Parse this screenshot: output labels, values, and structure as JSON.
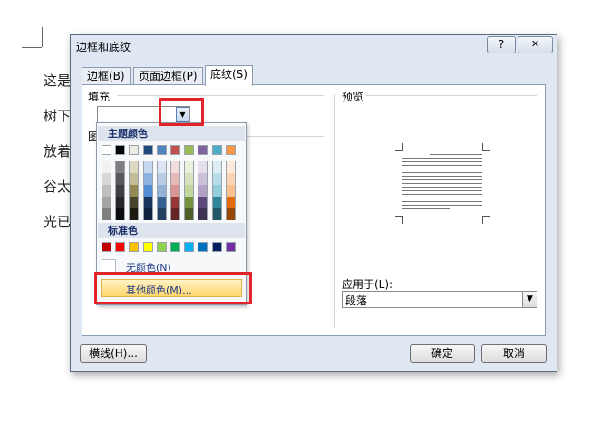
{
  "background_doc": {
    "lines": [
      "这是",
      "树下",
      "放着",
      "谷太",
      "光已"
    ]
  },
  "dialog": {
    "title": "边框和底纹",
    "help_label": "?",
    "close_label": "✕",
    "tabs": [
      {
        "label": "边框(B)"
      },
      {
        "label": "页面边框(P)"
      },
      {
        "label": "底纹(S)"
      }
    ],
    "fill_label": "填充",
    "pattern_label_partial": "图",
    "preview_label": "预览",
    "apply_to_label": "应用于(L):",
    "apply_to_value": "段落",
    "horizontal_line_button": "横线(H)...",
    "ok_button": "确定",
    "cancel_button": "取消"
  },
  "color_dropdown": {
    "theme_header": "主题颜色",
    "standard_header": "标准色",
    "no_color_label": "无颜色(N)",
    "more_colors_label": "其他颜色(M)...",
    "theme_top": [
      "#ffffff",
      "#000000",
      "#eeece1",
      "#1f497d",
      "#4f81bd",
      "#c0504d",
      "#9bbb59",
      "#8064a2",
      "#4bacc6",
      "#f79646"
    ],
    "theme_shades": [
      [
        "#f2f2f2",
        "#7f7f7f",
        "#ddd9c3",
        "#c6d9f0",
        "#dbe5f1",
        "#f2dcdb",
        "#ebf1dd",
        "#e5e0ec",
        "#dbeef3",
        "#fdeada"
      ],
      [
        "#d8d8d8",
        "#595959",
        "#c4bd97",
        "#8db3e2",
        "#b8cce4",
        "#e5b9b7",
        "#d7e3bc",
        "#ccc1d9",
        "#b7dde8",
        "#fbd5b5"
      ],
      [
        "#bfbfbf",
        "#3f3f3f",
        "#938953",
        "#548dd4",
        "#95b3d7",
        "#d99694",
        "#c3d69b",
        "#b2a2c7",
        "#92cddc",
        "#fac08f"
      ],
      [
        "#a5a5a5",
        "#262626",
        "#494429",
        "#17365d",
        "#366092",
        "#953734",
        "#76923c",
        "#5f497a",
        "#31859b",
        "#e36c09"
      ],
      [
        "#7f7f7f",
        "#0c0c0c",
        "#1d1b10",
        "#0f243e",
        "#244061",
        "#632423",
        "#4f6128",
        "#3f3151",
        "#205867",
        "#974806"
      ]
    ],
    "standard": [
      "#c00000",
      "#ff0000",
      "#ffc000",
      "#ffff00",
      "#92d050",
      "#00b050",
      "#00b0f0",
      "#0070c0",
      "#002060",
      "#7030a0"
    ]
  }
}
